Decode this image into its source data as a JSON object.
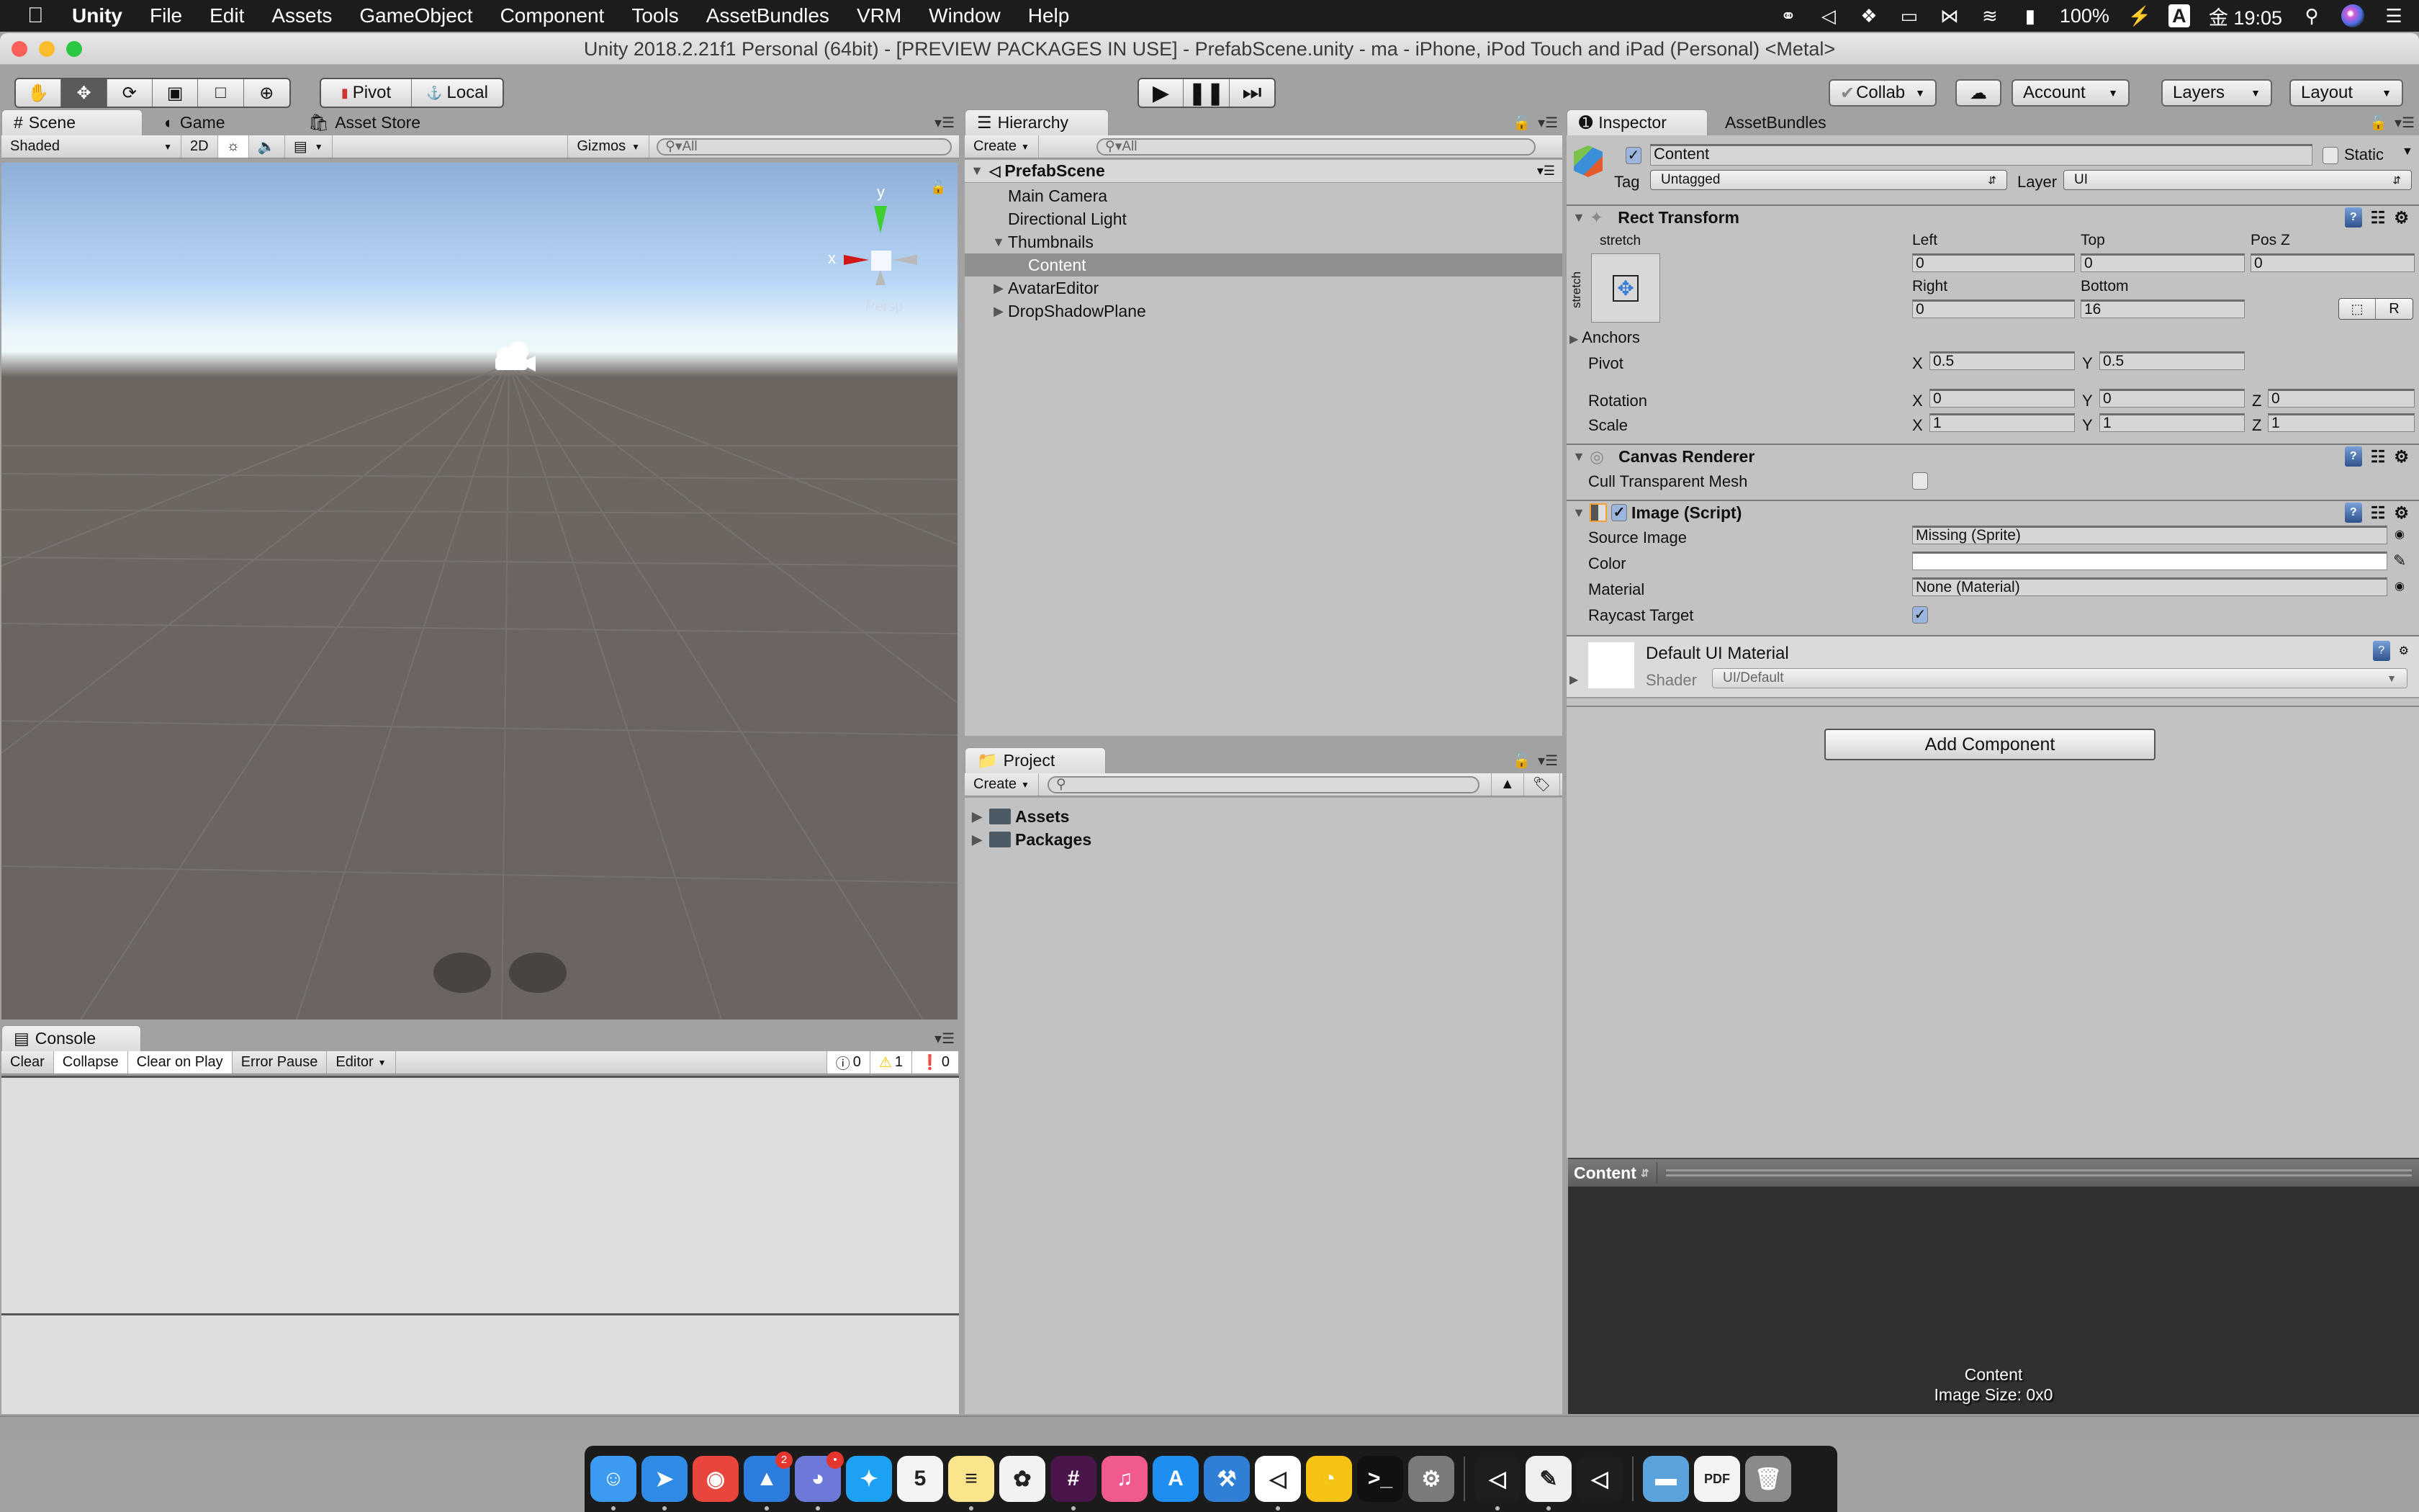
{
  "menubar": {
    "apple_icon": "apple-logo-icon",
    "items": [
      "Unity",
      "File",
      "Edit",
      "Assets",
      "GameObject",
      "Component",
      "Tools",
      "AssetBundles",
      "VRM",
      "Window",
      "Help"
    ],
    "status": {
      "battery": "100%",
      "input_source": "A",
      "clock": "金 19:05"
    }
  },
  "window": {
    "title": "Unity 2018.2.21f1 Personal (64bit) - [PREVIEW PACKAGES IN USE] - PrefabScene.unity - ma - iPhone, iPod Touch and iPad (Personal) <Metal>"
  },
  "toolbar": {
    "tools": [
      "hand-tool",
      "move-tool",
      "rotate-tool",
      "scale-tool",
      "rect-tool",
      "transform-tool"
    ],
    "active_tool": "move-tool",
    "pivot_label": "Pivot",
    "local_label": "Local",
    "collab_label": "Collab",
    "account_label": "Account",
    "layers_label": "Layers",
    "layout_label": "Layout"
  },
  "scene_panel": {
    "tabs": [
      "Scene",
      "Game",
      "Asset Store"
    ],
    "active_tab": "Scene",
    "shading_mode": "Shaded",
    "mode_2d_label": "2D",
    "gizmos_label": "Gizmos",
    "search_placeholder": "All",
    "gizmo_axes": {
      "x": "x",
      "y": "y"
    },
    "projection_label": "Persp"
  },
  "console_panel": {
    "tab": "Console",
    "buttons": [
      "Clear",
      "Collapse",
      "Clear on Play",
      "Error Pause",
      "Editor"
    ],
    "toggled": [
      "Collapse",
      "Clear on Play"
    ],
    "counts": {
      "info": "0",
      "warnings": "1",
      "errors": "0"
    }
  },
  "hierarchy_panel": {
    "tab": "Hierarchy",
    "create_label": "Create",
    "search_placeholder": "All",
    "scene_name": "PrefabScene",
    "items": [
      {
        "label": "Main Camera",
        "depth": 1,
        "expander": "none"
      },
      {
        "label": "Directional Light",
        "depth": 1,
        "expander": "none"
      },
      {
        "label": "Thumbnails",
        "depth": 1,
        "expander": "expanded"
      },
      {
        "label": "Content",
        "depth": 2,
        "expander": "none",
        "selected": true
      },
      {
        "label": "AvatarEditor",
        "depth": 1,
        "expander": "collapsed"
      },
      {
        "label": "DropShadowPlane",
        "depth": 1,
        "expander": "collapsed"
      }
    ]
  },
  "project_panel": {
    "tab": "Project",
    "create_label": "Create",
    "search_placeholder": "",
    "folders": [
      "Assets",
      "Packages"
    ]
  },
  "inspector_panel": {
    "tabs": [
      "Inspector",
      "AssetBundles"
    ],
    "active_tab": "Inspector",
    "object_name": "Content",
    "active": true,
    "static_label": "Static",
    "static": false,
    "tag_label": "Tag",
    "tag_value": "Untagged",
    "layer_label": "Layer",
    "layer_value": "UI",
    "rect_transform": {
      "title": "Rect Transform",
      "anchor_preset_h": "stretch",
      "anchor_preset_v": "stretch",
      "left_label": "Left",
      "left": "0",
      "top_label": "Top",
      "top": "0",
      "posz_label": "Pos Z",
      "posz": "0",
      "right_label": "Right",
      "right": "0",
      "bottom_label": "Bottom",
      "bottom": "16",
      "raw_edit_label": "R",
      "anchors_label": "Anchors",
      "pivot_label": "Pivot",
      "pivot_x": "0.5",
      "pivot_y": "0.5",
      "rotation_label": "Rotation",
      "rot_x": "0",
      "rot_y": "0",
      "rot_z": "0",
      "scale_label": "Scale",
      "scale_x": "1",
      "scale_y": "1",
      "scale_z": "1"
    },
    "canvas_renderer": {
      "title": "Canvas Renderer",
      "cull_label": "Cull Transparent Mesh",
      "cull": false
    },
    "image_script": {
      "title": "Image (Script)",
      "enabled": true,
      "source_image_label": "Source Image",
      "source_image": "Missing (Sprite)",
      "color_label": "Color",
      "color": "#ffffff",
      "material_label": "Material",
      "material": "None (Material)",
      "raycast_label": "Raycast Target",
      "raycast": true
    },
    "material": {
      "title": "Default UI Material",
      "shader_label": "Shader",
      "shader_value": "UI/Default"
    },
    "add_component_label": "Add Component",
    "preview": {
      "selector_label": "Content",
      "name": "Content",
      "size_text": "Image Size: 0x0"
    }
  },
  "dock": {
    "apps": [
      {
        "name": "Finder",
        "icon": "finder-icon",
        "bg": "#3c9bf0",
        "running": true
      },
      {
        "name": "Safari",
        "icon": "safari-icon",
        "bg": "#2f8be6",
        "running": true
      },
      {
        "name": "Chrome",
        "icon": "chrome-icon",
        "bg": "#e8453c",
        "running": false
      },
      {
        "name": "Spark",
        "icon": "spark-icon",
        "bg": "#2d7ddf",
        "badge": "2",
        "running": true
      },
      {
        "name": "Discord",
        "icon": "discord-icon",
        "bg": "#6d79d9",
        "badge": "•",
        "running": true
      },
      {
        "name": "Twitter",
        "icon": "twitter-icon",
        "bg": "#1da1f2",
        "running": false
      },
      {
        "name": "Calendar",
        "icon": "calendar-icon",
        "bg": "#f4f4f4",
        "label": "5",
        "running": false
      },
      {
        "name": "Notes",
        "icon": "notes-icon",
        "bg": "#fbe58c",
        "running": true
      },
      {
        "name": "Photos",
        "icon": "photos-icon",
        "bg": "#f2f2f2",
        "running": false
      },
      {
        "name": "Slack",
        "icon": "slack-icon",
        "bg": "#4a154b",
        "running": true
      },
      {
        "name": "iTunes",
        "icon": "itunes-icon",
        "bg": "#f05a8e",
        "running": false
      },
      {
        "name": "App Store",
        "icon": "app-store-icon",
        "bg": "#1f8ef1",
        "running": false
      },
      {
        "name": "Xcode",
        "icon": "xcode-icon",
        "bg": "#2f7fd6",
        "running": false
      },
      {
        "name": "Unity Hub",
        "icon": "unity-icon",
        "bg": "#ffffff",
        "running": true
      },
      {
        "name": "Cyberduck",
        "icon": "cyberduck-icon",
        "bg": "#f6c315",
        "running": false
      },
      {
        "name": "Terminal",
        "icon": "terminal-icon",
        "bg": "#111111",
        "running": false
      },
      {
        "name": "System Preferences",
        "icon": "system-preferences-icon",
        "bg": "#7a7a7a",
        "running": false
      },
      {
        "name": "Unity",
        "icon": "unity-icon",
        "bg": "#1e1e1e",
        "running": true,
        "group": 2
      },
      {
        "name": "TextEdit",
        "icon": "textedit-icon",
        "bg": "#f0f0f0",
        "running": true,
        "group": 2
      },
      {
        "name": "Unity",
        "icon": "unity-icon",
        "bg": "#1e1e1e",
        "running": false,
        "group": 2
      },
      {
        "name": "Downloads",
        "icon": "folder-icon",
        "bg": "#5aa3dc",
        "running": false,
        "group": 3
      },
      {
        "name": "Document",
        "icon": "pdf-icon",
        "bg": "#f4f4f4",
        "running": false,
        "group": 3
      },
      {
        "name": "Trash",
        "icon": "trash-icon",
        "bg": "#8a8a8a",
        "running": false,
        "group": 3
      }
    ]
  }
}
